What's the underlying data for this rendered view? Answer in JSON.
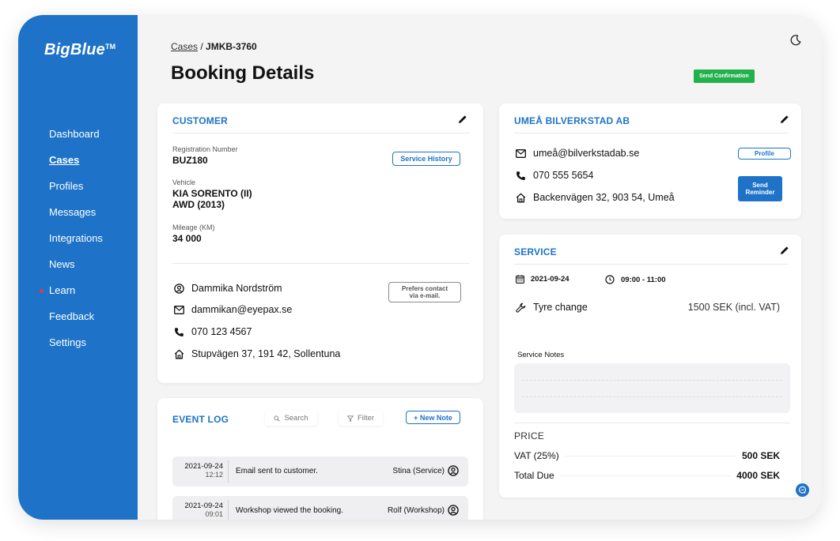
{
  "brand": {
    "name": "BigBlue",
    "mark": "TM"
  },
  "nav": [
    {
      "label": "Dashboard"
    },
    {
      "label": "Cases"
    },
    {
      "label": "Profiles"
    },
    {
      "label": "Messages"
    },
    {
      "label": "Integrations"
    },
    {
      "label": "News"
    },
    {
      "label": "Learn"
    },
    {
      "label": "Feedback"
    },
    {
      "label": "Settings"
    }
  ],
  "nav_active": "Cases",
  "nav_notification_item": "Learn",
  "breadcrumb": {
    "parent": "Cases",
    "separator": " / ",
    "current": "JMKB-3760"
  },
  "page_title": "Booking Details",
  "send_confirmation_label": "Send Confirmation",
  "colors": {
    "primary": "#1e73c8",
    "success": "#22b14c",
    "notification": "#e53935",
    "page_bg": "#f4f4f5"
  },
  "customer": {
    "title": "CUSTOMER",
    "registration_label": "Registration Number",
    "registration": "BUZ180",
    "service_history_label": "Service History",
    "vehicle_label": "Vehicle",
    "vehicle_line1": "KIA SORENTO (II)",
    "vehicle_line2": "AWD (2013)",
    "mileage_label": "Mileage (KM)",
    "mileage": "34 000",
    "name": "Dammika Nordström",
    "contact_pref_line1": "Prefers contact",
    "contact_pref_line2": "via e-mail.",
    "email": "dammikan@eyepax.se",
    "phone": "070 123 4567",
    "address": "Stupvägen 37, 191 42, Sollentuna"
  },
  "workshop": {
    "title": "UMEÅ BILVERKSTAD AB",
    "email": "umeå@bilverkstadab.se",
    "phone": "070 555 5654",
    "address": "Backenvägen 32, 903 54, Umeå",
    "profile_label": "Profile",
    "reminder_line1": "Send",
    "reminder_line2": "Reminder"
  },
  "service": {
    "title": "SERVICE",
    "date": "2021-09-24",
    "time": "09:00 - 11:00",
    "type": "Tyre change",
    "type_price": "1500 SEK (incl. VAT)",
    "notes_label": "Service Notes",
    "price_title": "PRICE",
    "vat_label": "VAT (25%)",
    "vat_value": "500 SEK",
    "total_label": "Total Due",
    "total_value": "4000 SEK"
  },
  "event_log": {
    "title": "EVENT LOG",
    "search_label": "Search",
    "filter_label": "Filter",
    "new_note_label": "+ New Note",
    "entries": [
      {
        "date": "2021-09-24",
        "time": "12:12",
        "text": "Email sent to customer.",
        "author": "Stina (Service)"
      },
      {
        "date": "2021-09-24",
        "time": "09:01",
        "text": "Workshop viewed the booking.",
        "author": "Rolf (Workshop)"
      }
    ]
  },
  "icons": [
    "moon-icon",
    "pencil-icon",
    "user-icon",
    "mail-icon",
    "phone-icon",
    "home-icon",
    "calendar-icon",
    "clock-icon",
    "wrench-icon",
    "search-icon",
    "filter-icon",
    "chat-icon"
  ]
}
